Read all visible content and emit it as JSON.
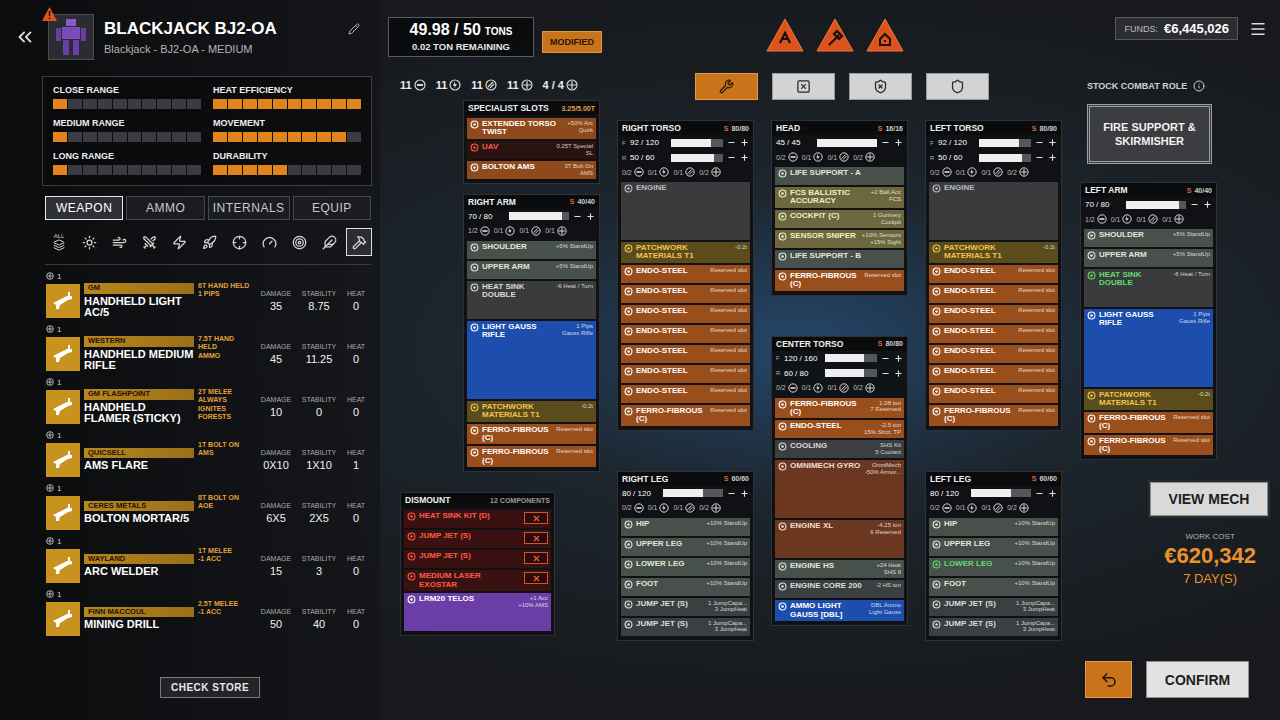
{
  "header": {
    "title": "BLACKJACK BJ2-OA",
    "subtitle": "Blackjack - BJ2-OA - MEDIUM"
  },
  "stats": [
    {
      "label": "CLOSE RANGE",
      "level": 0.1
    },
    {
      "label": "HEAT EFFICIENCY",
      "level": 1.0
    },
    {
      "label": "MEDIUM RANGE",
      "level": 0.1
    },
    {
      "label": "MOVEMENT",
      "level": 0.9
    },
    {
      "label": "LONG RANGE",
      "level": 0.1
    },
    {
      "label": "DURABILITY",
      "level": 0.5
    }
  ],
  "tabs": [
    {
      "label": "WEAPON",
      "selected": true
    },
    {
      "label": "AMMO",
      "selected": false
    },
    {
      "label": "INTERNALS",
      "selected": false
    },
    {
      "label": "EQUIP",
      "selected": false
    }
  ],
  "filters": [
    {
      "label": "ALL",
      "selected": false
    },
    {
      "selected": false
    },
    {
      "selected": false
    },
    {
      "selected": false
    },
    {
      "selected": false
    },
    {
      "selected": false
    },
    {
      "selected": false
    },
    {
      "selected": false
    },
    {
      "selected": false
    },
    {
      "selected": false
    },
    {
      "selected": true
    }
  ],
  "weapon_columns": [
    "DAMAGE",
    "STABILITY",
    "HEAT"
  ],
  "weapons": [
    {
      "count": "1",
      "brand": "GM",
      "name": "HANDHELD LIGHT AC/5",
      "tags": [
        "6T HAND HELD",
        "1 PIPS"
      ],
      "damage": "35",
      "stability": "8.75",
      "heat": "0"
    },
    {
      "count": "1",
      "brand": "WESTERN",
      "name": "HANDHELD MEDIUM RIFLE",
      "tags": [
        "7.5T HAND HELD",
        "AMMO"
      ],
      "damage": "45",
      "stability": "11.25",
      "heat": "0"
    },
    {
      "count": "1",
      "brand": "GM FLASHPOINT",
      "name": "HANDHELD FLAMER (STICKY)",
      "tags": [
        "2T MELEE",
        "ALWAYS IGNITES FORESTS"
      ],
      "damage": "10",
      "stability": "0",
      "heat": "0"
    },
    {
      "count": "1",
      "brand": "QUICSELL",
      "name": "AMS FLARE",
      "tags": [
        "1T BOLT ON",
        "AMS"
      ],
      "damage": "0X10",
      "stability": "1X10",
      "heat": "1"
    },
    {
      "count": "1",
      "brand": "CERES METALS",
      "name": "BOLTON MORTAR/5",
      "tags": [
        "8T BOLT ON",
        "AOE"
      ],
      "damage": "6X5",
      "stability": "2X5",
      "heat": "0"
    },
    {
      "count": "1",
      "brand": "WAYLAND",
      "name": "ARC WELDER",
      "tags": [
        "1T MELEE",
        "-1 ACC"
      ],
      "damage": "15",
      "stability": "3",
      "heat": "0"
    },
    {
      "count": "1",
      "brand": "FINN MACCOUL",
      "name": "MINING DRILL",
      "tags": [
        "2.5T MELEE",
        "-1 ACC"
      ],
      "damage": "50",
      "stability": "40",
      "heat": "0"
    }
  ],
  "check_store": "CHECK STORE",
  "tonnage": {
    "weight": "49.98 / 50",
    "unit": "TONS",
    "remaining": "0.02 TON REMAINING",
    "badge": "MODIFIED"
  },
  "hardpoints": {
    "counts": [
      "11",
      "11",
      "11",
      "11"
    ],
    "special": "4 / 4"
  },
  "warnings": [
    {
      "kind": "ammo"
    },
    {
      "kind": "repair"
    },
    {
      "kind": "danger"
    }
  ],
  "tools": [
    {
      "selected": true
    },
    {
      "selected": false
    },
    {
      "selected": false
    },
    {
      "selected": false
    }
  ],
  "funds": {
    "label": "FUNDS:",
    "value": "€6,445,026"
  },
  "combat_role": {
    "label": "STOCK COMBAT ROLE",
    "value": "FIRE SUPPORT & SKIRMISHER"
  },
  "specialist": {
    "title": "SPECIALIST SLOTS",
    "capacity": "3.25/5.00T",
    "items": [
      {
        "name": "EXTENDED TORSO TWIST",
        "detail": [
          "+50% Arc",
          "Quirk"
        ],
        "error": false
      },
      {
        "name": "UAV",
        "detail": [
          "0.25T Special",
          "SL"
        ],
        "error": true
      },
      {
        "name": "BOLTON AMS",
        "detail": [
          "3T Bolt On",
          "AMS"
        ],
        "error": false
      }
    ]
  },
  "structure_label": "S",
  "parts": {
    "right_arm": {
      "name": "RIGHT ARM",
      "structure": "40/40",
      "armor": [
        {
          "value": "70 / 80",
          "level": 0.875
        }
      ],
      "hardpoints": [
        "1/2",
        "0/1",
        "0/1",
        "0/1"
      ],
      "slots": [
        {
          "name": "SHOULDER",
          "detail": [
            "+5% StandUp"
          ],
          "kind": "actuator",
          "modified": false
        },
        {
          "name": "UPPER ARM",
          "detail": [
            "+5% StandUp"
          ],
          "kind": "actuator",
          "modified": false
        },
        {
          "name": "HEAT SINK DOUBLE",
          "detail": [
            "-6 Heat / Turn"
          ],
          "kind": "heatsink",
          "modified": false
        },
        {
          "name": "LIGHT GAUSS RIFLE",
          "detail": [
            "1 Pips",
            "Gauss Rifle"
          ],
          "kind": "weapon",
          "modified": false
        },
        {
          "name": "PATCHWORK MATERIALS T1",
          "detail": [
            "-0.2t"
          ],
          "kind": "quirk",
          "modified": false
        },
        {
          "name": "FERRO-FIBROUS (C)",
          "detail": [
            "Reserved slot"
          ],
          "kind": "structure",
          "modified": false
        },
        {
          "name": "FERRO-FIBROUS (C)",
          "detail": [
            "Reserved slot"
          ],
          "kind": "structure",
          "modified": false
        }
      ]
    },
    "right_torso": {
      "name": "RIGHT TORSO",
      "structure": "80/80",
      "armor": [
        {
          "label": "F",
          "value": "92 / 120",
          "level": 0.77
        },
        {
          "label": "R",
          "value": "50 / 60",
          "level": 0.83
        }
      ],
      "hardpoints": [
        "0/2",
        "0/1",
        "0/1",
        "0/2"
      ],
      "slots": [
        {
          "name": "ENGINE",
          "detail": [],
          "kind": "engine",
          "modified": false
        },
        {
          "name": "PATCHWORK MATERIALS T1",
          "detail": [
            "-0.2t"
          ],
          "kind": "quirk",
          "modified": false
        },
        {
          "name": "ENDO-STEEL",
          "detail": [
            "Reserved slot"
          ],
          "kind": "structure",
          "modified": false
        },
        {
          "name": "ENDO-STEEL",
          "detail": [
            "Reserved slot"
          ],
          "kind": "structure",
          "modified": false
        },
        {
          "name": "ENDO-STEEL",
          "detail": [
            "Reserved slot"
          ],
          "kind": "structure",
          "modified": false
        },
        {
          "name": "ENDO-STEEL",
          "detail": [
            "Reserved slot"
          ],
          "kind": "structure",
          "modified": false
        },
        {
          "name": "ENDO-STEEL",
          "detail": [
            "Reserved slot"
          ],
          "kind": "structure",
          "modified": false
        },
        {
          "name": "ENDO-STEEL",
          "detail": [
            "Reserved slot"
          ],
          "kind": "structure",
          "modified": false
        },
        {
          "name": "ENDO-STEEL",
          "detail": [
            "Reserved slot"
          ],
          "kind": "structure",
          "modified": false
        },
        {
          "name": "FERRO-FIBROUS (C)",
          "detail": [
            "Reserved slot"
          ],
          "kind": "structure",
          "modified": false
        }
      ]
    },
    "head": {
      "name": "HEAD",
      "structure": "16/16",
      "armor": [
        {
          "value": "45 / 45",
          "level": 1.0
        }
      ],
      "hardpoints": [
        "0/2",
        "0/1",
        "0/1",
        "0/2"
      ],
      "slots": [
        {
          "name": "LIFE SUPPORT - A",
          "detail": [],
          "kind": "actuator",
          "modified": false
        },
        {
          "name": "FCS BALLISTIC ACCURACY",
          "detail": [
            "+2 Ball.Acc",
            "FCS"
          ],
          "kind": "system",
          "modified": false
        },
        {
          "name": "COCKPIT (C)",
          "detail": [
            "1 Gunnery",
            "Cockpit"
          ],
          "kind": "system",
          "modified": false
        },
        {
          "name": "SENSOR SNIPER",
          "detail": [
            "+10% Sensors",
            "+15% Sight"
          ],
          "kind": "system",
          "modified": false
        },
        {
          "name": "LIFE SUPPORT - B",
          "detail": [],
          "kind": "actuator",
          "modified": false
        },
        {
          "name": "FERRO-FIBROUS (C)",
          "detail": [
            "Reserved slot"
          ],
          "kind": "structure",
          "modified": false
        }
      ]
    },
    "center_torso": {
      "name": "CENTER TORSO",
      "structure": "80/80",
      "armor": [
        {
          "label": "F",
          "value": "120 / 160",
          "level": 0.75
        },
        {
          "label": "R",
          "value": "60 / 80",
          "level": 0.75
        }
      ],
      "hardpoints": [
        "0/2",
        "0/1",
        "0/1",
        "0/2"
      ],
      "slots": [
        {
          "name": "FERRO-FIBROUS (C)",
          "detail": [
            "1.08 ton",
            "7 Reserved"
          ],
          "kind": "structure",
          "modified": false
        },
        {
          "name": "ENDO-STEEL",
          "detail": [
            "-2.5 ton",
            "15% Strct. TP"
          ],
          "kind": "structure",
          "modified": false
        },
        {
          "name": "COOLING",
          "detail": [
            "SHS Kit",
            "5 Coolant"
          ],
          "kind": "core",
          "modified": false
        },
        {
          "name": "OMNIMECH GYRO",
          "detail": [
            "OmniMech",
            "-50% Armor..."
          ],
          "kind": "gyro",
          "modified": false
        },
        {
          "name": "ENGINE XL",
          "detail": [
            "-4.25 ton",
            "6 Reserved"
          ],
          "kind": "xl",
          "modified": false
        },
        {
          "name": "ENGINE HS",
          "detail": [
            "+24 Heat",
            "SHS 8"
          ],
          "kind": "actuator",
          "modified": false
        },
        {
          "name": "ENGINE CORE 200",
          "detail": [
            "-2 HS ton"
          ],
          "kind": "core",
          "modified": false
        },
        {
          "name": "AMMO LIGHT GAUSS [DBL]",
          "detail": [
            "DBL Ammo",
            "Light Gauss"
          ],
          "kind": "ammo",
          "modified": false
        }
      ]
    },
    "left_torso": {
      "name": "LEFT TORSO",
      "structure": "80/80",
      "armor": [
        {
          "label": "F",
          "value": "92 / 120",
          "level": 0.77
        },
        {
          "label": "R",
          "value": "50 / 60",
          "level": 0.83
        }
      ],
      "hardpoints": [
        "0/2",
        "0/1",
        "0/1",
        "0/2"
      ],
      "slots": [
        {
          "name": "ENGINE",
          "detail": [],
          "kind": "engine",
          "modified": false
        },
        {
          "name": "PATCHWORK MATERIALS T1",
          "detail": [
            "-0.2t"
          ],
          "kind": "quirk",
          "modified": false
        },
        {
          "name": "ENDO-STEEL",
          "detail": [
            "Reserved slot"
          ],
          "kind": "structure",
          "modified": false
        },
        {
          "name": "ENDO-STEEL",
          "detail": [
            "Reserved slot"
          ],
          "kind": "structure",
          "modified": false
        },
        {
          "name": "ENDO-STEEL",
          "detail": [
            "Reserved slot"
          ],
          "kind": "structure",
          "modified": false
        },
        {
          "name": "ENDO-STEEL",
          "detail": [
            "Reserved slot"
          ],
          "kind": "structure",
          "modified": false
        },
        {
          "name": "ENDO-STEEL",
          "detail": [
            "Reserved slot"
          ],
          "kind": "structure",
          "modified": false
        },
        {
          "name": "ENDO-STEEL",
          "detail": [
            "Reserved slot"
          ],
          "kind": "structure",
          "modified": false
        },
        {
          "name": "ENDO-STEEL",
          "detail": [
            "Reserved slot"
          ],
          "kind": "structure",
          "modified": false
        },
        {
          "name": "FERRO-FIBROUS (C)",
          "detail": [
            "Reserved slot"
          ],
          "kind": "structure",
          "modified": false
        }
      ]
    },
    "left_arm": {
      "name": "LEFT ARM",
      "structure": "40/40",
      "armor": [
        {
          "value": "70 / 80",
          "level": 0.875
        }
      ],
      "hardpoints": [
        "1/2",
        "0/1",
        "0/1",
        "0/1"
      ],
      "slots": [
        {
          "name": "SHOULDER",
          "detail": [
            "+5% StandUp"
          ],
          "kind": "actuator",
          "modified": false
        },
        {
          "name": "UPPER ARM",
          "detail": [
            "+5% StandUp"
          ],
          "kind": "actuator",
          "modified": false
        },
        {
          "name": "HEAT SINK DOUBLE",
          "detail": [
            "-6 Heat / Turn"
          ],
          "kind": "heatsink",
          "modified": true
        },
        {
          "name": "LIGHT GAUSS RIFLE",
          "detail": [
            "1 Pips",
            "Gauss Rifle"
          ],
          "kind": "weapon",
          "modified": false
        },
        {
          "name": "PATCHWORK MATERIALS T1",
          "detail": [
            "-0.2t"
          ],
          "kind": "quirk",
          "modified": false
        },
        {
          "name": "FERRO-FIBROUS (C)",
          "detail": [
            "Reserved slot"
          ],
          "kind": "structure",
          "modified": false
        },
        {
          "name": "FERRO-FIBROUS (C)",
          "detail": [
            "Reserved slot"
          ],
          "kind": "structure",
          "modified": false
        }
      ]
    },
    "right_leg": {
      "name": "RIGHT LEG",
      "structure": "60/60",
      "armor": [
        {
          "value": "80 / 120",
          "level": 0.67
        }
      ],
      "hardpoints": [
        "0/2",
        "0/1",
        "0/1",
        "0/2"
      ],
      "slots": [
        {
          "name": "HIP",
          "detail": [
            "+10% StandUp"
          ],
          "kind": "actuator",
          "modified": false
        },
        {
          "name": "UPPER LEG",
          "detail": [
            "+10% StandUp"
          ],
          "kind": "actuator",
          "modified": false
        },
        {
          "name": "LOWER LEG",
          "detail": [
            "+10% StandUp"
          ],
          "kind": "actuator",
          "modified": false
        },
        {
          "name": "FOOT",
          "detail": [
            "+10% StandUp"
          ],
          "kind": "actuator",
          "modified": false
        },
        {
          "name": "JUMP JET (S)",
          "detail": [
            "1 JumpCapa...",
            "3 JumpHeat"
          ],
          "kind": "core",
          "modified": false
        },
        {
          "name": "JUMP JET (S)",
          "detail": [
            "1 JumpCapa...",
            "3 JumpHeat"
          ],
          "kind": "core",
          "modified": false
        }
      ]
    },
    "left_leg": {
      "name": "LEFT LEG",
      "structure": "60/60",
      "armor": [
        {
          "value": "80 / 120",
          "level": 0.67
        }
      ],
      "hardpoints": [
        "0/2",
        "0/1",
        "0/1",
        "0/2"
      ],
      "slots": [
        {
          "name": "HIP",
          "detail": [
            "+10% StandUp"
          ],
          "kind": "actuator",
          "modified": false
        },
        {
          "name": "UPPER LEG",
          "detail": [
            "+10% StandUp"
          ],
          "kind": "actuator",
          "modified": false
        },
        {
          "name": "LOWER LEG",
          "detail": [
            "+10% StandUp"
          ],
          "kind": "actuator",
          "modified": true
        },
        {
          "name": "FOOT",
          "detail": [
            "+10% StandUp"
          ],
          "kind": "actuator",
          "modified": false
        },
        {
          "name": "JUMP JET (S)",
          "detail": [
            "1 JumpCapa...",
            "3 JumpHeat"
          ],
          "kind": "core",
          "modified": false
        },
        {
          "name": "JUMP JET (S)",
          "detail": [
            "1 JumpCapa...",
            "3 JumpHeat"
          ],
          "kind": "core",
          "modified": false
        }
      ]
    }
  },
  "dismount": {
    "title": "DISMOUNT",
    "count": "12 COMPONENTS",
    "items": [
      {
        "name": "HEAT SINK KIT (D)",
        "detail": [],
        "kind": "remove"
      },
      {
        "name": "JUMP JET (S)",
        "detail": [],
        "kind": "remove"
      },
      {
        "name": "JUMP JET (S)",
        "detail": [],
        "kind": "remove"
      },
      {
        "name": "MEDIUM LASER EXOSTAR",
        "detail": [],
        "kind": "remove"
      },
      {
        "name": "LRM20 TELOS",
        "detail": [
          "+1 Acc",
          "+10% AMS"
        ],
        "kind": "install"
      }
    ]
  },
  "view_mech": "VIEW MECH",
  "work_cost": {
    "label": "WORK COST",
    "value": "€620,342",
    "time": "7 DAY(S)"
  },
  "confirm": "CONFIRM"
}
